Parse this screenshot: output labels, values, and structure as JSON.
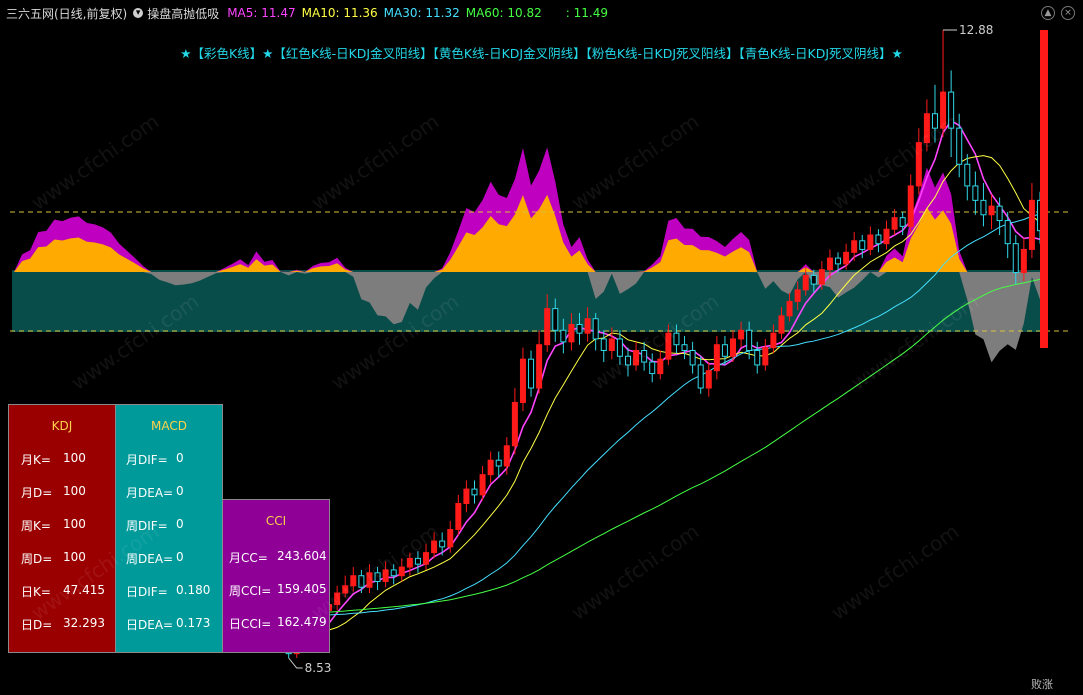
{
  "header": {
    "stock_title": "三六五网(日线,前复权)",
    "indicator_name": "操盘高抛低吸",
    "ma5": "MA5: 11.47",
    "ma10": "MA10: 11.36",
    "ma30": "MA30: 11.32",
    "ma60": "MA60: 10.82",
    "last": ": 11.49",
    "colors": {
      "ma5": "#ff44ff",
      "ma10": "#ffff44",
      "ma30": "#44e0ff",
      "ma60": "#44ff44",
      "last": "#44ff44"
    }
  },
  "legend_text": "★【彩色K线】★【红色K线-日KDJ金叉阳线】【黄色K线-日KDJ金叉阴线】【粉色K线-日KDJ死叉阳线】【青色K线-日KDJ死叉阴线】★",
  "panels": {
    "kdj": {
      "title": "KDJ",
      "bg": "#9b0000",
      "rows": [
        {
          "k": "月K=",
          "v": "100"
        },
        {
          "k": "月D=",
          "v": "100"
        },
        {
          "k": "周K=",
          "v": "100"
        },
        {
          "k": "周D=",
          "v": "100"
        },
        {
          "k": "日K=",
          "v": "47.415"
        },
        {
          "k": "日D=",
          "v": "32.293"
        }
      ]
    },
    "macd": {
      "title": "MACD",
      "bg": "#009a9a",
      "rows": [
        {
          "k": "月DIF=",
          "v": "0"
        },
        {
          "k": "月DEA=",
          "v": "0"
        },
        {
          "k": "周DIF=",
          "v": "0"
        },
        {
          "k": "周DEA=",
          "v": "0"
        },
        {
          "k": "日DIF=",
          "v": "0.180"
        },
        {
          "k": "日DEA=",
          "v": "0.173"
        }
      ]
    },
    "cci": {
      "title": "CCI",
      "bg": "#8e0096",
      "rows": [
        {
          "k": "月CC=",
          "v": "243.604"
        },
        {
          "k": "周CCI=",
          "v": "159.405"
        },
        {
          "k": "日CCI=",
          "v": "162.479"
        }
      ]
    }
  },
  "watermark": "www.cfchi.com",
  "corner_text": "败涨",
  "chart_data": {
    "type": "candlestick",
    "price_axis": {
      "min": 8.53,
      "max": 12.88
    },
    "annotations": [
      {
        "label": "12.88",
        "kind": "high"
      },
      {
        "label": "8.53",
        "kind": "low"
      }
    ],
    "candles": [
      {
        "o": 8.95,
        "c": 8.85,
        "h": 9.02,
        "l": 8.8
      },
      {
        "o": 8.85,
        "c": 8.92,
        "h": 8.98,
        "l": 8.8
      },
      {
        "o": 8.9,
        "c": 8.86,
        "h": 8.95,
        "l": 8.8
      },
      {
        "o": 8.86,
        "c": 8.95,
        "h": 9.0,
        "l": 8.82
      },
      {
        "o": 8.95,
        "c": 8.88,
        "h": 9.0,
        "l": 8.85
      },
      {
        "o": 8.88,
        "c": 8.93,
        "h": 8.98,
        "l": 8.84
      },
      {
        "o": 8.93,
        "c": 8.87,
        "h": 8.97,
        "l": 8.83
      },
      {
        "o": 8.87,
        "c": 8.95,
        "h": 9.01,
        "l": 8.85
      },
      {
        "o": 8.95,
        "c": 8.9,
        "h": 8.99,
        "l": 8.86
      },
      {
        "o": 8.9,
        "c": 8.94,
        "h": 8.98,
        "l": 8.87
      },
      {
        "o": 8.94,
        "c": 8.89,
        "h": 8.97,
        "l": 8.85
      },
      {
        "o": 8.89,
        "c": 8.96,
        "h": 9.0,
        "l": 8.86
      },
      {
        "o": 8.96,
        "c": 8.91,
        "h": 9.0,
        "l": 8.87
      },
      {
        "o": 8.91,
        "c": 8.95,
        "h": 8.99,
        "l": 8.88
      },
      {
        "o": 8.95,
        "c": 8.9,
        "h": 8.98,
        "l": 8.86
      },
      {
        "o": 8.9,
        "c": 8.94,
        "h": 8.98,
        "l": 8.87
      },
      {
        "o": 8.94,
        "c": 8.88,
        "h": 8.97,
        "l": 8.84
      },
      {
        "o": 8.88,
        "c": 8.93,
        "h": 8.97,
        "l": 8.85
      },
      {
        "o": 8.93,
        "c": 8.87,
        "h": 8.96,
        "l": 8.83
      },
      {
        "o": 8.87,
        "c": 8.92,
        "h": 8.96,
        "l": 8.84
      },
      {
        "o": 8.92,
        "c": 8.86,
        "h": 8.95,
        "l": 8.82
      },
      {
        "o": 8.86,
        "c": 8.91,
        "h": 8.95,
        "l": 8.82
      },
      {
        "o": 8.91,
        "c": 8.85,
        "h": 8.94,
        "l": 8.8
      },
      {
        "o": 8.85,
        "c": 8.9,
        "h": 8.94,
        "l": 8.81
      },
      {
        "o": 8.9,
        "c": 8.84,
        "h": 8.93,
        "l": 8.8
      },
      {
        "o": 8.84,
        "c": 8.88,
        "h": 8.92,
        "l": 8.8
      },
      {
        "o": 8.88,
        "c": 8.82,
        "h": 8.91,
        "l": 8.78
      },
      {
        "o": 8.82,
        "c": 8.86,
        "h": 8.9,
        "l": 8.78
      },
      {
        "o": 8.86,
        "c": 8.8,
        "h": 8.89,
        "l": 8.76
      },
      {
        "o": 8.8,
        "c": 8.75,
        "h": 8.84,
        "l": 8.7
      },
      {
        "o": 8.75,
        "c": 8.8,
        "h": 8.85,
        "l": 8.71
      },
      {
        "o": 8.8,
        "c": 8.72,
        "h": 8.83,
        "l": 8.68
      },
      {
        "o": 8.72,
        "c": 8.68,
        "h": 8.76,
        "l": 8.64
      },
      {
        "o": 8.68,
        "c": 8.62,
        "h": 8.71,
        "l": 8.58
      },
      {
        "o": 8.62,
        "c": 8.56,
        "h": 8.65,
        "l": 8.53
      },
      {
        "o": 8.56,
        "c": 8.62,
        "h": 8.68,
        "l": 8.53
      },
      {
        "o": 8.62,
        "c": 8.7,
        "h": 8.75,
        "l": 8.58
      },
      {
        "o": 8.7,
        "c": 8.78,
        "h": 8.84,
        "l": 8.66
      },
      {
        "o": 8.78,
        "c": 8.86,
        "h": 8.92,
        "l": 8.74
      },
      {
        "o": 8.86,
        "c": 8.9,
        "h": 8.96,
        "l": 8.82
      },
      {
        "o": 8.9,
        "c": 8.98,
        "h": 9.03,
        "l": 8.86
      },
      {
        "o": 8.98,
        "c": 9.03,
        "h": 9.1,
        "l": 8.95
      },
      {
        "o": 9.03,
        "c": 9.1,
        "h": 9.16,
        "l": 8.99
      },
      {
        "o": 9.1,
        "c": 9.02,
        "h": 9.14,
        "l": 8.98
      },
      {
        "o": 9.02,
        "c": 9.12,
        "h": 9.18,
        "l": 8.98
      },
      {
        "o": 9.12,
        "c": 9.06,
        "h": 9.16,
        "l": 9.0
      },
      {
        "o": 9.06,
        "c": 9.14,
        "h": 9.2,
        "l": 9.02
      },
      {
        "o": 9.14,
        "c": 9.1,
        "h": 9.18,
        "l": 9.04
      },
      {
        "o": 9.1,
        "c": 9.16,
        "h": 9.22,
        "l": 9.06
      },
      {
        "o": 9.16,
        "c": 9.22,
        "h": 9.26,
        "l": 9.1
      },
      {
        "o": 9.22,
        "c": 9.18,
        "h": 9.27,
        "l": 9.12
      },
      {
        "o": 9.18,
        "c": 9.26,
        "h": 9.32,
        "l": 9.14
      },
      {
        "o": 9.26,
        "c": 9.34,
        "h": 9.4,
        "l": 9.22
      },
      {
        "o": 9.34,
        "c": 9.3,
        "h": 9.4,
        "l": 9.24
      },
      {
        "o": 9.3,
        "c": 9.42,
        "h": 9.48,
        "l": 9.26
      },
      {
        "o": 9.42,
        "c": 9.6,
        "h": 9.66,
        "l": 9.38
      },
      {
        "o": 9.6,
        "c": 9.7,
        "h": 9.76,
        "l": 9.54
      },
      {
        "o": 9.7,
        "c": 9.66,
        "h": 9.76,
        "l": 9.6
      },
      {
        "o": 9.66,
        "c": 9.8,
        "h": 9.86,
        "l": 9.62
      },
      {
        "o": 9.8,
        "c": 9.9,
        "h": 9.96,
        "l": 9.74
      },
      {
        "o": 9.9,
        "c": 9.86,
        "h": 9.96,
        "l": 9.78
      },
      {
        "o": 9.86,
        "c": 10.0,
        "h": 10.06,
        "l": 9.8
      },
      {
        "o": 10.0,
        "c": 10.3,
        "h": 10.4,
        "l": 9.94
      },
      {
        "o": 10.3,
        "c": 10.6,
        "h": 10.68,
        "l": 10.24
      },
      {
        "o": 10.6,
        "c": 10.4,
        "h": 10.66,
        "l": 10.34
      },
      {
        "o": 10.4,
        "c": 10.7,
        "h": 10.8,
        "l": 10.36
      },
      {
        "o": 10.7,
        "c": 10.95,
        "h": 11.05,
        "l": 10.65
      },
      {
        "o": 10.95,
        "c": 10.8,
        "h": 11.02,
        "l": 10.72
      },
      {
        "o": 10.8,
        "c": 10.72,
        "h": 10.88,
        "l": 10.64
      },
      {
        "o": 10.72,
        "c": 10.84,
        "h": 10.92,
        "l": 10.66
      },
      {
        "o": 10.84,
        "c": 10.78,
        "h": 10.92,
        "l": 10.7
      },
      {
        "o": 10.78,
        "c": 10.88,
        "h": 10.96,
        "l": 10.72
      },
      {
        "o": 10.88,
        "c": 10.74,
        "h": 10.92,
        "l": 10.66
      },
      {
        "o": 10.74,
        "c": 10.66,
        "h": 10.8,
        "l": 10.58
      },
      {
        "o": 10.66,
        "c": 10.74,
        "h": 10.82,
        "l": 10.6
      },
      {
        "o": 10.74,
        "c": 10.62,
        "h": 10.8,
        "l": 10.56
      },
      {
        "o": 10.62,
        "c": 10.56,
        "h": 10.68,
        "l": 10.48
      },
      {
        "o": 10.56,
        "c": 10.66,
        "h": 10.72,
        "l": 10.52
      },
      {
        "o": 10.66,
        "c": 10.58,
        "h": 10.72,
        "l": 10.52
      },
      {
        "o": 10.58,
        "c": 10.5,
        "h": 10.64,
        "l": 10.44
      },
      {
        "o": 10.5,
        "c": 10.6,
        "h": 10.66,
        "l": 10.46
      },
      {
        "o": 10.6,
        "c": 10.78,
        "h": 10.84,
        "l": 10.56
      },
      {
        "o": 10.78,
        "c": 10.7,
        "h": 10.84,
        "l": 10.64
      },
      {
        "o": 10.7,
        "c": 10.66,
        "h": 10.76,
        "l": 10.6
      },
      {
        "o": 10.66,
        "c": 10.56,
        "h": 10.72,
        "l": 10.5
      },
      {
        "o": 10.56,
        "c": 10.4,
        "h": 10.62,
        "l": 10.36
      },
      {
        "o": 10.4,
        "c": 10.52,
        "h": 10.58,
        "l": 10.34
      },
      {
        "o": 10.52,
        "c": 10.7,
        "h": 10.76,
        "l": 10.46
      },
      {
        "o": 10.7,
        "c": 10.62,
        "h": 10.76,
        "l": 10.56
      },
      {
        "o": 10.62,
        "c": 10.74,
        "h": 10.8,
        "l": 10.58
      },
      {
        "o": 10.74,
        "c": 10.8,
        "h": 10.86,
        "l": 10.68
      },
      {
        "o": 10.8,
        "c": 10.66,
        "h": 10.86,
        "l": 10.6
      },
      {
        "o": 10.66,
        "c": 10.56,
        "h": 10.72,
        "l": 10.5
      },
      {
        "o": 10.56,
        "c": 10.68,
        "h": 10.74,
        "l": 10.52
      },
      {
        "o": 10.68,
        "c": 10.78,
        "h": 10.84,
        "l": 10.64
      },
      {
        "o": 10.78,
        "c": 10.9,
        "h": 10.96,
        "l": 10.74
      },
      {
        "o": 10.9,
        "c": 11.0,
        "h": 11.06,
        "l": 10.86
      },
      {
        "o": 11.0,
        "c": 11.08,
        "h": 11.14,
        "l": 10.94
      },
      {
        "o": 11.08,
        "c": 11.18,
        "h": 11.24,
        "l": 11.04
      },
      {
        "o": 11.18,
        "c": 11.12,
        "h": 11.22,
        "l": 11.06
      },
      {
        "o": 11.12,
        "c": 11.22,
        "h": 11.28,
        "l": 11.08
      },
      {
        "o": 11.22,
        "c": 11.3,
        "h": 11.36,
        "l": 11.16
      },
      {
        "o": 11.3,
        "c": 11.26,
        "h": 11.34,
        "l": 11.2
      },
      {
        "o": 11.26,
        "c": 11.34,
        "h": 11.4,
        "l": 11.22
      },
      {
        "o": 11.34,
        "c": 11.42,
        "h": 11.48,
        "l": 11.28
      },
      {
        "o": 11.42,
        "c": 11.36,
        "h": 11.46,
        "l": 11.3
      },
      {
        "o": 11.36,
        "c": 11.46,
        "h": 11.52,
        "l": 11.32
      },
      {
        "o": 11.46,
        "c": 11.4,
        "h": 11.5,
        "l": 11.34
      },
      {
        "o": 11.4,
        "c": 11.5,
        "h": 11.56,
        "l": 11.36
      },
      {
        "o": 11.5,
        "c": 11.58,
        "h": 11.64,
        "l": 11.46
      },
      {
        "o": 11.58,
        "c": 11.52,
        "h": 11.62,
        "l": 11.46
      },
      {
        "o": 11.52,
        "c": 11.8,
        "h": 11.88,
        "l": 11.48
      },
      {
        "o": 11.8,
        "c": 12.1,
        "h": 12.2,
        "l": 11.74
      },
      {
        "o": 12.1,
        "c": 12.3,
        "h": 12.4,
        "l": 12.04
      },
      {
        "o": 12.3,
        "c": 12.2,
        "h": 12.5,
        "l": 12.1
      },
      {
        "o": 12.2,
        "c": 12.45,
        "h": 12.88,
        "l": 12.14
      },
      {
        "o": 12.45,
        "c": 12.2,
        "h": 12.6,
        "l": 12.0
      },
      {
        "o": 12.2,
        "c": 11.95,
        "h": 12.3,
        "l": 11.86
      },
      {
        "o": 11.95,
        "c": 11.8,
        "h": 12.02,
        "l": 11.7
      },
      {
        "o": 11.8,
        "c": 11.7,
        "h": 11.9,
        "l": 11.6
      },
      {
        "o": 11.7,
        "c": 11.6,
        "h": 11.82,
        "l": 11.52
      },
      {
        "o": 11.6,
        "c": 11.66,
        "h": 11.74,
        "l": 11.5
      },
      {
        "o": 11.66,
        "c": 11.56,
        "h": 11.72,
        "l": 11.46
      },
      {
        "o": 11.56,
        "c": 11.4,
        "h": 11.62,
        "l": 11.3
      },
      {
        "o": 11.4,
        "c": 11.2,
        "h": 11.46,
        "l": 11.12
      },
      {
        "o": 11.2,
        "c": 11.36,
        "h": 11.44,
        "l": 11.14
      },
      {
        "o": 11.36,
        "c": 11.7,
        "h": 11.82,
        "l": 11.3
      },
      {
        "o": 11.7,
        "c": 11.49,
        "h": 11.76,
        "l": 11.4
      }
    ],
    "ma_series": [
      {
        "name": "MA5"
      },
      {
        "name": "MA10"
      },
      {
        "name": "MA30"
      },
      {
        "name": "MA60"
      }
    ]
  }
}
